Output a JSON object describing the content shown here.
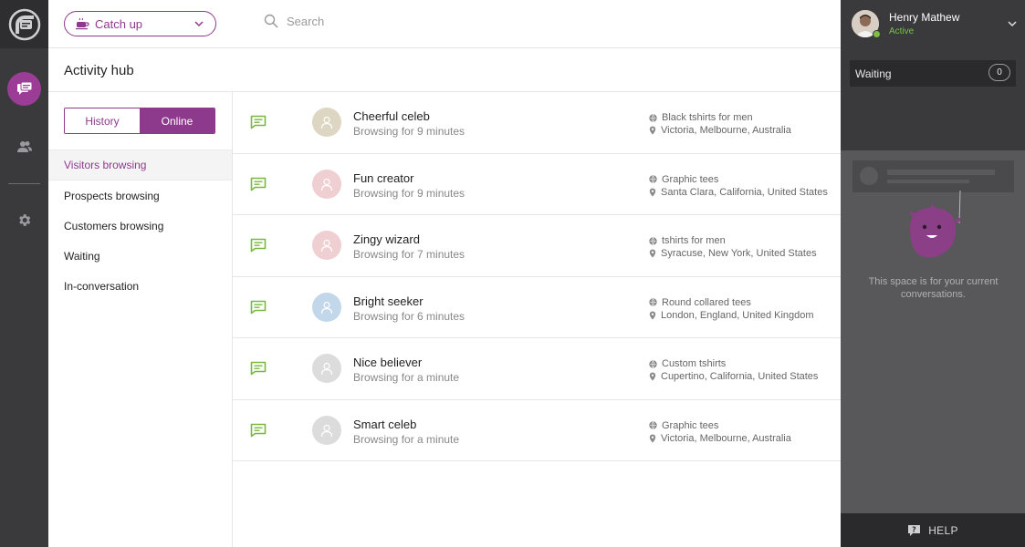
{
  "topbar": {
    "mode_label": "Catch up",
    "search_placeholder": "Search"
  },
  "page": {
    "title": "Activity hub"
  },
  "toggle": {
    "history": "History",
    "online": "Online",
    "selected": "Online"
  },
  "filters": [
    {
      "label": "Visitors browsing",
      "active": true
    },
    {
      "label": "Prospects browsing",
      "active": false
    },
    {
      "label": "Customers browsing",
      "active": false
    },
    {
      "label": "Waiting",
      "active": false
    },
    {
      "label": "In-conversation",
      "active": false
    }
  ],
  "visitors": [
    {
      "name": "Cheerful celeb",
      "time": "Browsing for 9 minutes",
      "page": "Black tshirts for men",
      "location": "Victoria, Melbourne, Australia",
      "avatar_color": "#dcd6c2"
    },
    {
      "name": "Fun creator",
      "time": "Browsing for 9 minutes",
      "page": "Graphic tees",
      "location": "Santa Clara, California, United States",
      "avatar_color": "#efcfd1"
    },
    {
      "name": "Zingy wizard",
      "time": "Browsing for 7 minutes",
      "page": "tshirts for men",
      "location": "Syracuse, New York, United States",
      "avatar_color": "#efcfd1"
    },
    {
      "name": "Bright seeker",
      "time": "Browsing for 6 minutes",
      "page": "Round collared tees",
      "location": "London, England, United Kingdom",
      "avatar_color": "#c3d7ea"
    },
    {
      "name": "Nice believer",
      "time": "Browsing for a minute",
      "page": "Custom tshirts",
      "location": "Cupertino, California, United States",
      "avatar_color": "#dcdcdc"
    },
    {
      "name": "Smart celeb",
      "time": "Browsing for a minute",
      "page": "Graphic tees",
      "location": "Victoria, Melbourne, Australia",
      "avatar_color": "#dcdcdc"
    }
  ],
  "user": {
    "name": "Henry Mathew",
    "status": "Active"
  },
  "waiting": {
    "label": "Waiting",
    "count": "0"
  },
  "conversations": {
    "empty_message": "This space is for your current conversations."
  },
  "help": {
    "label": "HELP"
  },
  "colors": {
    "accent": "#8e3a8c",
    "chat_green": "#7bb73f",
    "status_green": "#7bc043"
  }
}
